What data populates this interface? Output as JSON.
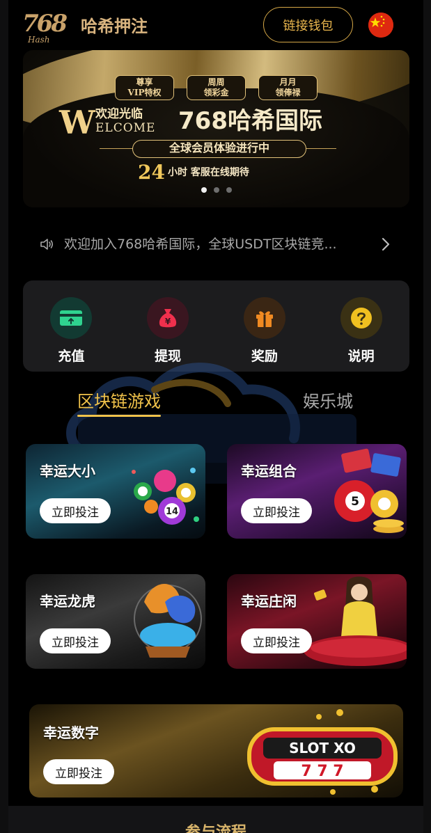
{
  "header": {
    "logo_number": "768",
    "logo_sub": "Hash",
    "brand": "哈希押注",
    "wallet_button": "链接钱包",
    "language_flag": "china-flag-icon"
  },
  "banner": {
    "tags": [
      "尊享\nVIP特权",
      "周周\n领彩金",
      "月月\n领俸禄"
    ],
    "big_letter": "W",
    "welcome_cn": "欢迎光临",
    "welcome_en": "ELCOME",
    "title": "768哈希国际",
    "pill": "全球会员体验进行中",
    "service_number": "24",
    "service_text": "小时 客服在线期待",
    "dots": 3,
    "active_dot": 0
  },
  "notice": {
    "text": "欢迎加入768哈希国际，全球USDT区块链竞..."
  },
  "actions": [
    {
      "label": "充值",
      "icon": "card-icon",
      "bg": "#123a32",
      "color": "#2fd38f"
    },
    {
      "label": "提现",
      "icon": "money-bag-icon",
      "bg": "#3a1620",
      "color": "#f0304d"
    },
    {
      "label": "奖励",
      "icon": "gift-icon",
      "bg": "#3a2614",
      "color": "#f08a22"
    },
    {
      "label": "说明",
      "icon": "question-icon",
      "bg": "#3a3114",
      "color": "#f0c020"
    }
  ],
  "tabs": {
    "active": "区块链游戏",
    "inactive": "娱乐城"
  },
  "games": [
    {
      "name": "幸运大小",
      "button": "立即投注"
    },
    {
      "name": "幸运组合",
      "button": "立即投注"
    },
    {
      "name": "幸运龙虎",
      "button": "立即投注"
    },
    {
      "name": "幸运庄闲",
      "button": "立即投注"
    },
    {
      "name": "幸运数字",
      "button": "立即投注"
    }
  ],
  "footer": {
    "title": "参与流程"
  }
}
